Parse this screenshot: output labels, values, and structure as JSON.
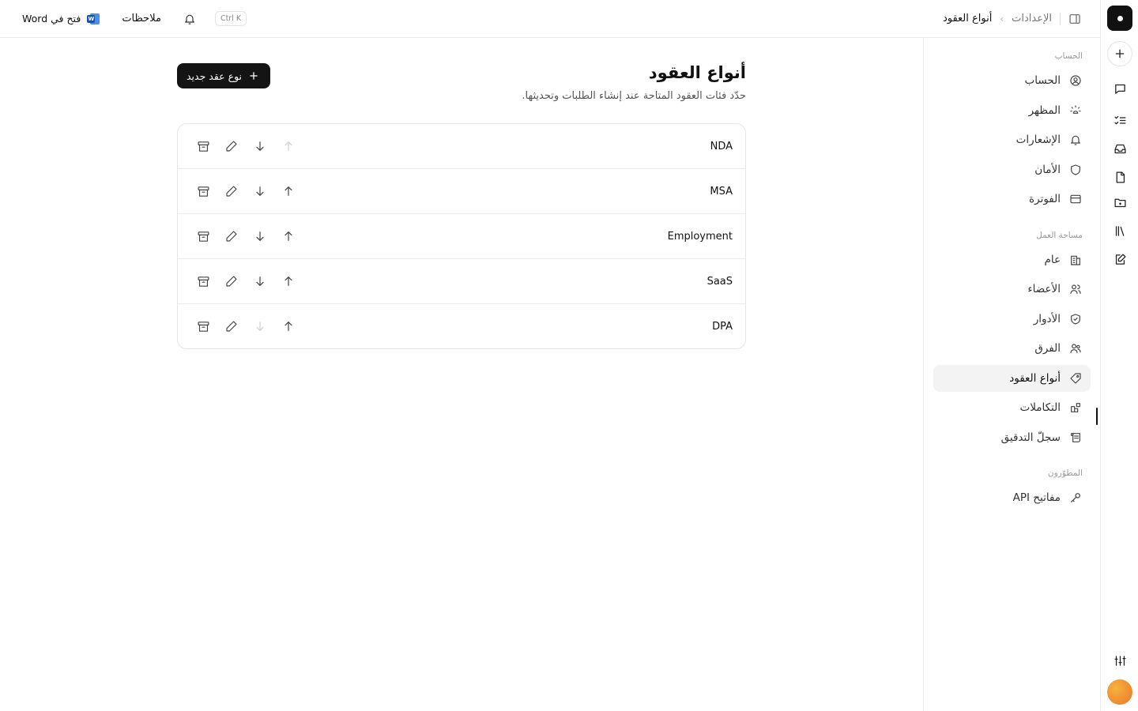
{
  "topbar": {
    "breadcrumb_parent": "الإعدادات",
    "breadcrumb_separator": "›",
    "breadcrumb_current": "أنواع العقود",
    "open_in_word_label": "فتح في Word",
    "word_icon_letter": "W",
    "notes_label": "ملاحظات",
    "shortcut_label": "Ctrl K"
  },
  "sidebar": {
    "sections": [
      {
        "title": "الحساب",
        "items": [
          {
            "label": "الحساب",
            "icon": "user-circle-icon"
          },
          {
            "label": "المظهر",
            "icon": "sun-moon-icon"
          },
          {
            "label": "الإشعارات",
            "icon": "bell-icon"
          },
          {
            "label": "الأمان",
            "icon": "shield-icon"
          },
          {
            "label": "الفوترة",
            "icon": "credit-card-icon"
          }
        ]
      },
      {
        "title": "مساحة العمل",
        "items": [
          {
            "label": "عام",
            "icon": "building-icon"
          },
          {
            "label": "الأعضاء",
            "icon": "users-icon"
          },
          {
            "label": "الأدوار",
            "icon": "shield-check-icon"
          },
          {
            "label": "الفرق",
            "icon": "team-icon"
          },
          {
            "label": "أنواع العقود",
            "icon": "tag-icon",
            "active": true
          },
          {
            "label": "التكاملات",
            "icon": "blocks-icon"
          },
          {
            "label": "سجلّ التدقيق",
            "icon": "scroll-icon"
          }
        ]
      },
      {
        "title": "المطوّرون",
        "items": [
          {
            "label": "مفاتيح API",
            "icon": "key-icon"
          }
        ]
      }
    ]
  },
  "main": {
    "title": "أنواع العقود",
    "subtitle": "حدّد فئات العقود المتاحة عند إنشاء الطلبات وتحديثها.",
    "new_button_label": "نوع عقد جديد",
    "types": [
      {
        "name": "NDA",
        "move_up_enabled": false,
        "move_down_enabled": true
      },
      {
        "name": "MSA",
        "move_up_enabled": true,
        "move_down_enabled": true
      },
      {
        "name": "Employment",
        "move_up_enabled": true,
        "move_down_enabled": true
      },
      {
        "name": "SaaS",
        "move_up_enabled": true,
        "move_down_enabled": true
      },
      {
        "name": "DPA",
        "move_up_enabled": true,
        "move_down_enabled": false
      }
    ]
  },
  "rail": {
    "items": [
      "logo-icon",
      "new-icon",
      "chat-icon",
      "checklist-icon",
      "inbox-icon",
      "document-icon",
      "folder-icon",
      "library-icon",
      "edit-note-icon",
      "sliders-icon",
      "avatar"
    ]
  },
  "colors": {
    "accent": "#141414",
    "active_bg": "#f3f3f3",
    "border": "#ebebeb",
    "avatar": "#f0962e",
    "word_blue": "#1a4fb5"
  }
}
